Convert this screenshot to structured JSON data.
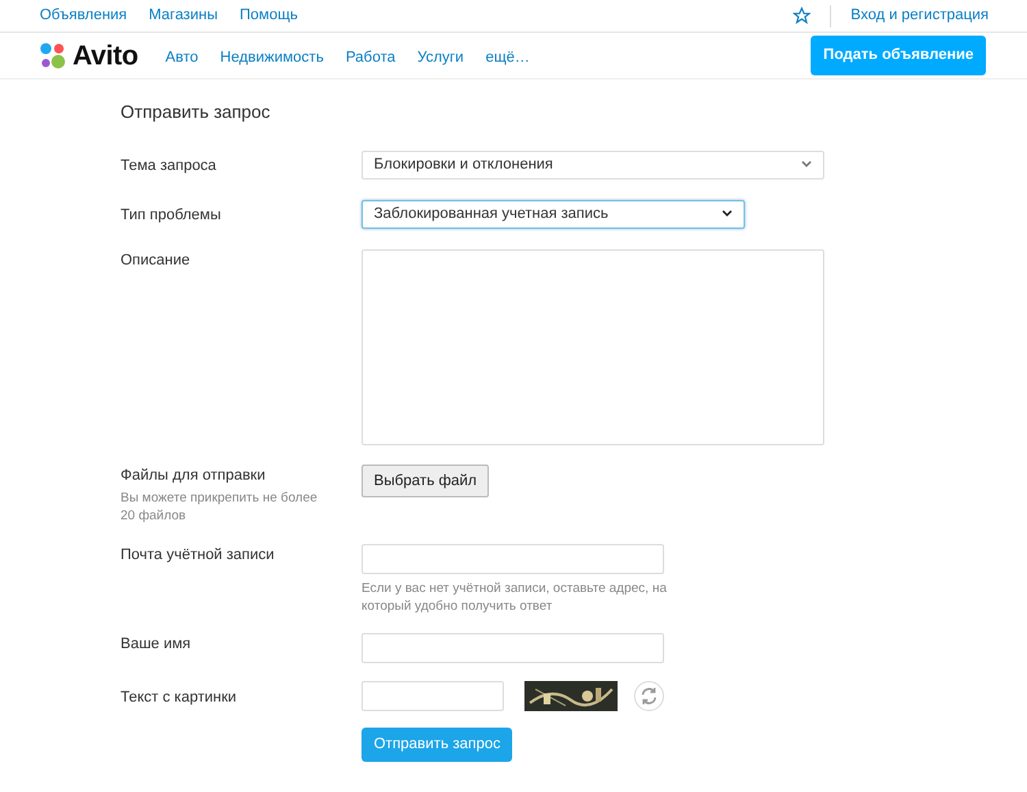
{
  "top_links": [
    "Объявления",
    "Магазины",
    "Помощь"
  ],
  "login": "Вход и регистрация",
  "logo": "Avito",
  "nav": [
    "Авто",
    "Недвижимость",
    "Работа",
    "Услуги",
    "ещё…"
  ],
  "post_button": "Подать объявление",
  "title": "Отправить запрос",
  "fields": [
    {
      "kind": "select",
      "label": "Тема запроса",
      "value": "Блокировки и отклонения",
      "focused": false
    },
    {
      "kind": "select",
      "label": "Тип проблемы",
      "value": "Заблокированная учетная запись",
      "focused": true
    },
    {
      "kind": "textarea",
      "label": "Описание"
    },
    {
      "kind": "file",
      "label": "Файлы для отправки",
      "note": "Вы можете прикрепить не более 20 файлов",
      "button": "Выбрать файл"
    },
    {
      "kind": "input",
      "label": "Почта учётной записи",
      "hint": "Если у вас нет учётной записи, оставьте адрес, на который удобно получить ответ"
    },
    {
      "kind": "input",
      "label": "Ваше имя"
    },
    {
      "kind": "captcha",
      "label": "Текст с картинки"
    }
  ],
  "submit": "Отправить запрос"
}
